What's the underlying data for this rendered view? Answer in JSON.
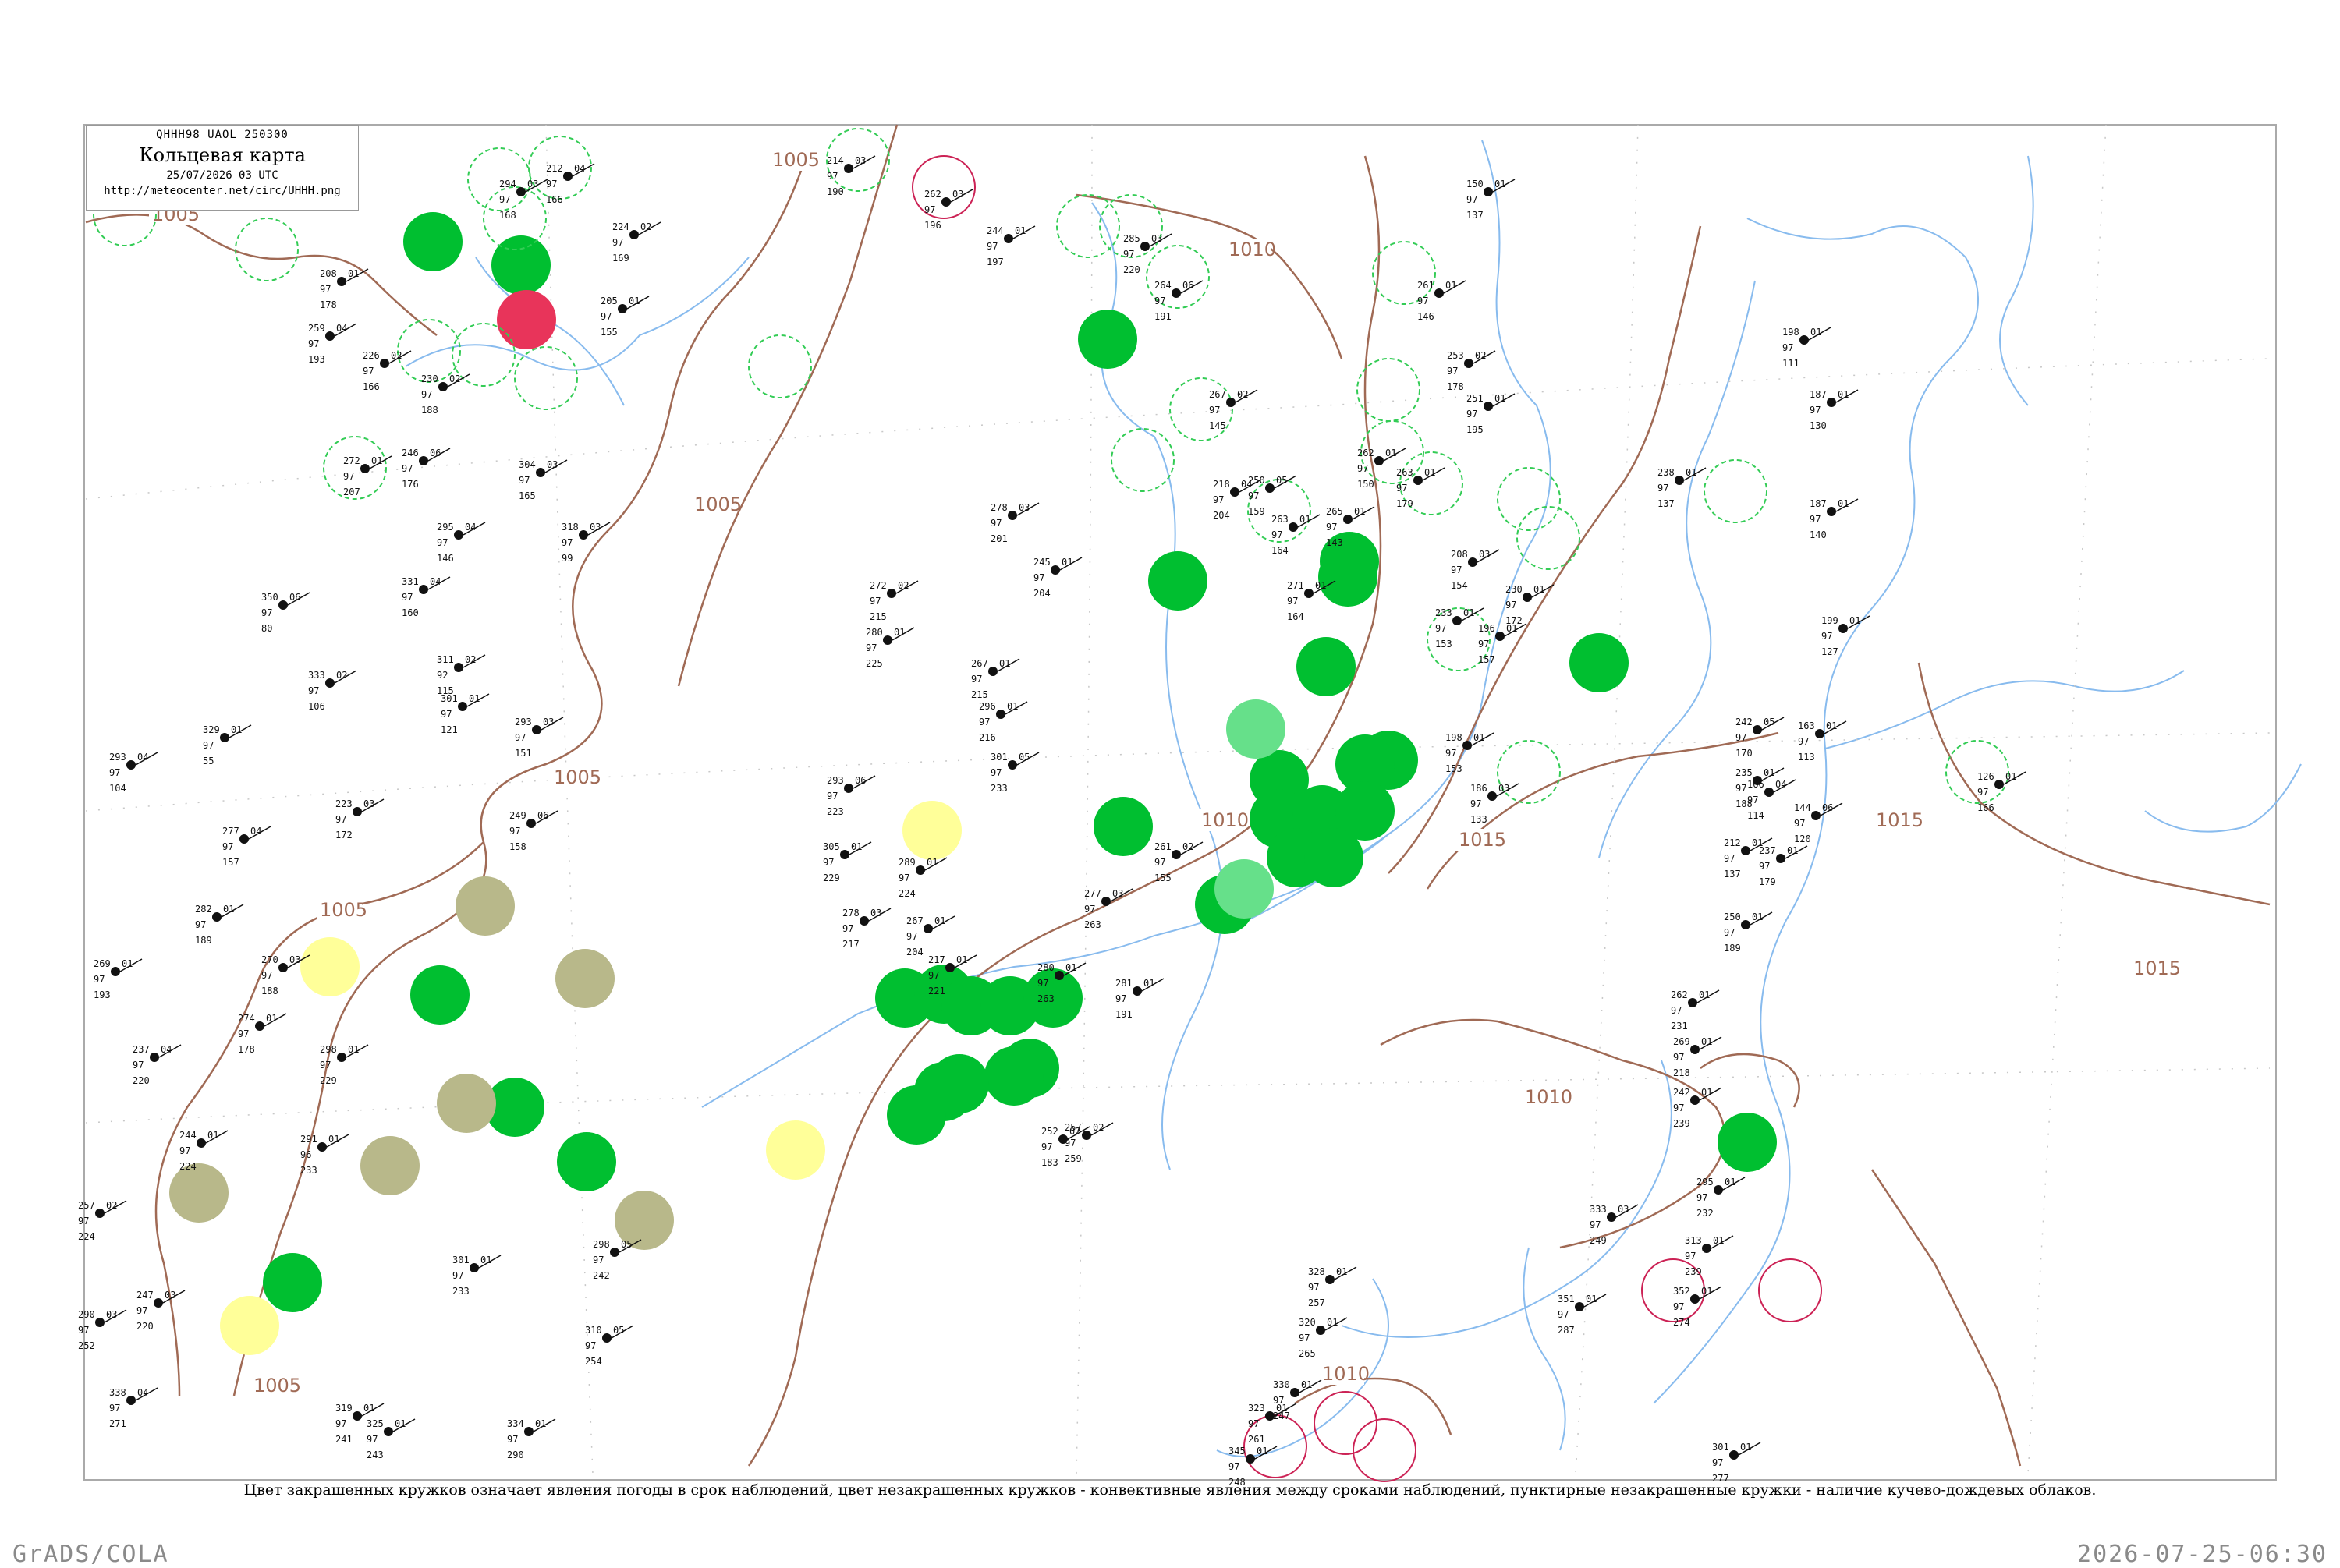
{
  "map": {
    "code_line": "QHHH98  UAOL  250300",
    "title": "Кольцевая карта",
    "date": "25/07/2026 03 UTC",
    "url": "http://meteocenter.net/circ/UHHH.png",
    "caption": "Цвет закрашенных кружков означает явления погоды в срок наблюдений, цвет незакрашенных кружков - конвективные явления между сроками наблюдений, пунктирные незакрашенные кружки - наличие кучево-дождевых облаков.",
    "isobar_labels": [
      "1005",
      "1005",
      "1005",
      "1005",
      "1005",
      "1005",
      "1010",
      "1010",
      "1010",
      "1010",
      "1015",
      "1015",
      "1015"
    ],
    "colors": {
      "rain": "#00bf30",
      "rain_light": "#66e08a",
      "drizzle": "#ffff99",
      "haze": "#b8b88a",
      "thunder": "#e8345a",
      "convective_ring": "#33cc55",
      "thunder_ring": "#cc2255",
      "isobar": "#a06a55",
      "river": "#88bbee"
    },
    "stations": [
      {
        "p": "294",
        "t": "97",
        "td": "03",
        "n": "168"
      },
      {
        "p": "212",
        "t": "97",
        "td": "04",
        "n": "166"
      },
      {
        "p": "214",
        "t": "97",
        "td": "03",
        "n": "190"
      },
      {
        "p": "262",
        "t": "97",
        "td": "03",
        "n": "196"
      },
      {
        "p": "244",
        "t": "97",
        "td": "01",
        "n": "197"
      },
      {
        "p": "285",
        "t": "97",
        "td": "03",
        "n": "220"
      },
      {
        "p": "205",
        "t": "97",
        "td": "01",
        "n": "155"
      },
      {
        "p": "224",
        "t": "97",
        "td": "02",
        "n": "169"
      },
      {
        "p": "208",
        "t": "97",
        "td": "01",
        "n": "178"
      },
      {
        "p": "259",
        "t": "97",
        "td": "04",
        "n": "193"
      },
      {
        "p": "226",
        "t": "97",
        "td": "02",
        "n": "166"
      },
      {
        "p": "230",
        "t": "97",
        "td": "02",
        "n": "188"
      },
      {
        "p": "272",
        "t": "97",
        "td": "01",
        "n": "207"
      },
      {
        "p": "246",
        "t": "97",
        "td": "06",
        "n": "176"
      },
      {
        "p": "304",
        "t": "97",
        "td": "03",
        "n": "165"
      },
      {
        "p": "318",
        "t": "97",
        "td": "03",
        "n": "99"
      },
      {
        "p": "295",
        "t": "97",
        "td": "04",
        "n": "146"
      },
      {
        "p": "331",
        "t": "97",
        "td": "04",
        "n": "160"
      },
      {
        "p": "350",
        "t": "97",
        "td": "06",
        "n": "80"
      },
      {
        "p": "333",
        "t": "97",
        "td": "02",
        "n": "106"
      },
      {
        "p": "329",
        "t": "97",
        "td": "01",
        "n": "55"
      },
      {
        "p": "293",
        "t": "97",
        "td": "04",
        "n": "104"
      },
      {
        "p": "311",
        "t": "92",
        "td": "02",
        "n": "115"
      },
      {
        "p": "301",
        "t": "97",
        "td": "01",
        "n": "121"
      },
      {
        "p": "293",
        "t": "97",
        "td": "03",
        "n": "151"
      },
      {
        "p": "223",
        "t": "97",
        "td": "03",
        "n": "172"
      },
      {
        "p": "249",
        "t": "97",
        "td": "06",
        "n": "158"
      },
      {
        "p": "277",
        "t": "97",
        "td": "04",
        "n": "157"
      },
      {
        "p": "270",
        "t": "97",
        "td": "03",
        "n": "188"
      },
      {
        "p": "269",
        "t": "97",
        "td": "01",
        "n": "193"
      },
      {
        "p": "282",
        "t": "97",
        "td": "01",
        "n": "189"
      },
      {
        "p": "237",
        "t": "97",
        "td": "04",
        "n": "220"
      },
      {
        "p": "274",
        "t": "97",
        "td": "01",
        "n": "178"
      },
      {
        "p": "298",
        "t": "97",
        "td": "01",
        "n": "229"
      },
      {
        "p": "291",
        "t": "96",
        "td": "01",
        "n": "233"
      },
      {
        "p": "244",
        "t": "97",
        "td": "01",
        "n": "224"
      },
      {
        "p": "257",
        "t": "97",
        "td": "02",
        "n": "224"
      },
      {
        "p": "290",
        "t": "97",
        "td": "03",
        "n": "252"
      },
      {
        "p": "247",
        "t": "97",
        "td": "03",
        "n": "220"
      },
      {
        "p": "338",
        "t": "97",
        "td": "04",
        "n": "271"
      },
      {
        "p": "325",
        "t": "97",
        "td": "01",
        "n": "243"
      },
      {
        "p": "319",
        "t": "97",
        "td": "01",
        "n": "241"
      },
      {
        "p": "334",
        "t": "97",
        "td": "01",
        "n": "290"
      },
      {
        "p": "310",
        "t": "97",
        "td": "05",
        "n": "254"
      },
      {
        "p": "298",
        "t": "97",
        "td": "05",
        "n": "242"
      },
      {
        "p": "301",
        "t": "97",
        "td": "01",
        "n": "233"
      },
      {
        "p": "278",
        "t": "97",
        "td": "03",
        "n": "201"
      },
      {
        "p": "245",
        "t": "97",
        "td": "01",
        "n": "204"
      },
      {
        "p": "272",
        "t": "97",
        "td": "02",
        "n": "215"
      },
      {
        "p": "280",
        "t": "97",
        "td": "01",
        "n": "225"
      },
      {
        "p": "267",
        "t": "97",
        "td": "01",
        "n": "215"
      },
      {
        "p": "296",
        "t": "97",
        "td": "01",
        "n": "216"
      },
      {
        "p": "301",
        "t": "97",
        "td": "05",
        "n": "233"
      },
      {
        "p": "293",
        "t": "97",
        "td": "06",
        "n": "223"
      },
      {
        "p": "305",
        "t": "97",
        "td": "01",
        "n": "229"
      },
      {
        "p": "289",
        "t": "97",
        "td": "01",
        "n": "224"
      },
      {
        "p": "278",
        "t": "97",
        "td": "03",
        "n": "217"
      },
      {
        "p": "267",
        "t": "97",
        "td": "01",
        "n": "204"
      },
      {
        "p": "217",
        "t": "97",
        "td": "01",
        "n": "221"
      },
      {
        "p": "280",
        "t": "97",
        "td": "01",
        "n": "263"
      },
      {
        "p": "277",
        "t": "97",
        "td": "03",
        "n": "263"
      },
      {
        "p": "257",
        "t": "97",
        "td": "02",
        "n": "259"
      },
      {
        "p": "252",
        "t": "97",
        "td": "02",
        "n": "183"
      },
      {
        "p": "281",
        "t": "97",
        "td": "01",
        "n": "191"
      },
      {
        "p": "261",
        "t": "97",
        "td": "02",
        "n": "155"
      },
      {
        "p": "264",
        "t": "97",
        "td": "06",
        "n": "191"
      },
      {
        "p": "267",
        "t": "97",
        "td": "02",
        "n": "145"
      },
      {
        "p": "218",
        "t": "97",
        "td": "04",
        "n": "204"
      },
      {
        "p": "250",
        "t": "97",
        "td": "05",
        "n": "159"
      },
      {
        "p": "263",
        "t": "97",
        "td": "01",
        "n": "164"
      },
      {
        "p": "271",
        "t": "97",
        "td": "01",
        "n": "164"
      },
      {
        "p": "265",
        "t": "97",
        "td": "01",
        "n": "143"
      },
      {
        "p": "262",
        "t": "97",
        "td": "01",
        "n": "150"
      },
      {
        "p": "263",
        "t": "97",
        "td": "01",
        "n": "179"
      },
      {
        "p": "261",
        "t": "97",
        "td": "01",
        "n": "146"
      },
      {
        "p": "253",
        "t": "97",
        "td": "02",
        "n": "178"
      },
      {
        "p": "251",
        "t": "97",
        "td": "01",
        "n": "195"
      },
      {
        "p": "208",
        "t": "97",
        "td": "03",
        "n": "154"
      },
      {
        "p": "230",
        "t": "97",
        "td": "01",
        "n": "172"
      },
      {
        "p": "233",
        "t": "97",
        "td": "01",
        "n": "153"
      },
      {
        "p": "196",
        "t": "97",
        "td": "01",
        "n": "157"
      },
      {
        "p": "198",
        "t": "97",
        "td": "01",
        "n": "153"
      },
      {
        "p": "186",
        "t": "97",
        "td": "03",
        "n": "133"
      },
      {
        "p": "242",
        "t": "97",
        "td": "05",
        "n": "170"
      },
      {
        "p": "235",
        "t": "97",
        "td": "01",
        "n": "188"
      },
      {
        "p": "212",
        "t": "97",
        "td": "01",
        "n": "137"
      },
      {
        "p": "250",
        "t": "97",
        "td": "01",
        "n": "189"
      },
      {
        "p": "262",
        "t": "97",
        "td": "01",
        "n": "231"
      },
      {
        "p": "269",
        "t": "97",
        "td": "01",
        "n": "218"
      },
      {
        "p": "242",
        "t": "97",
        "td": "01",
        "n": "239"
      },
      {
        "p": "295",
        "t": "97",
        "td": "01",
        "n": "232"
      },
      {
        "p": "313",
        "t": "97",
        "td": "01",
        "n": "239"
      },
      {
        "p": "333",
        "t": "97",
        "td": "03",
        "n": "249"
      },
      {
        "p": "352",
        "t": "97",
        "td": "01",
        "n": "274"
      },
      {
        "p": "351",
        "t": "97",
        "td": "01",
        "n": "287"
      },
      {
        "p": "328",
        "t": "97",
        "td": "01",
        "n": "257"
      },
      {
        "p": "320",
        "t": "97",
        "td": "01",
        "n": "265"
      },
      {
        "p": "330",
        "t": "97",
        "td": "01",
        "n": "247"
      },
      {
        "p": "323",
        "t": "97",
        "td": "01",
        "n": "261"
      },
      {
        "p": "345",
        "t": "97",
        "td": "01",
        "n": "248"
      },
      {
        "p": "301",
        "t": "97",
        "td": "01",
        "n": "277"
      },
      {
        "p": "187",
        "t": "97",
        "td": "01",
        "n": "140"
      },
      {
        "p": "199",
        "t": "97",
        "td": "01",
        "n": "127"
      },
      {
        "p": "198",
        "t": "97",
        "td": "01",
        "n": "111"
      },
      {
        "p": "187",
        "t": "97",
        "td": "01",
        "n": "130"
      },
      {
        "p": "150",
        "t": "97",
        "td": "01",
        "n": "137"
      },
      {
        "p": "163",
        "t": "97",
        "td": "01",
        "n": "113"
      },
      {
        "p": "166",
        "t": "97",
        "td": "04",
        "n": "114"
      },
      {
        "p": "144",
        "t": "97",
        "td": "06",
        "n": "120"
      },
      {
        "p": "126",
        "t": "97",
        "td": "01",
        "n": "166"
      },
      {
        "p": "238",
        "t": "97",
        "td": "01",
        "n": "137"
      },
      {
        "p": "237",
        "t": "97",
        "td": "01",
        "n": "179"
      }
    ]
  },
  "footer": {
    "left": "GrADS/COLA",
    "right": "2026-07-25-06:30"
  }
}
